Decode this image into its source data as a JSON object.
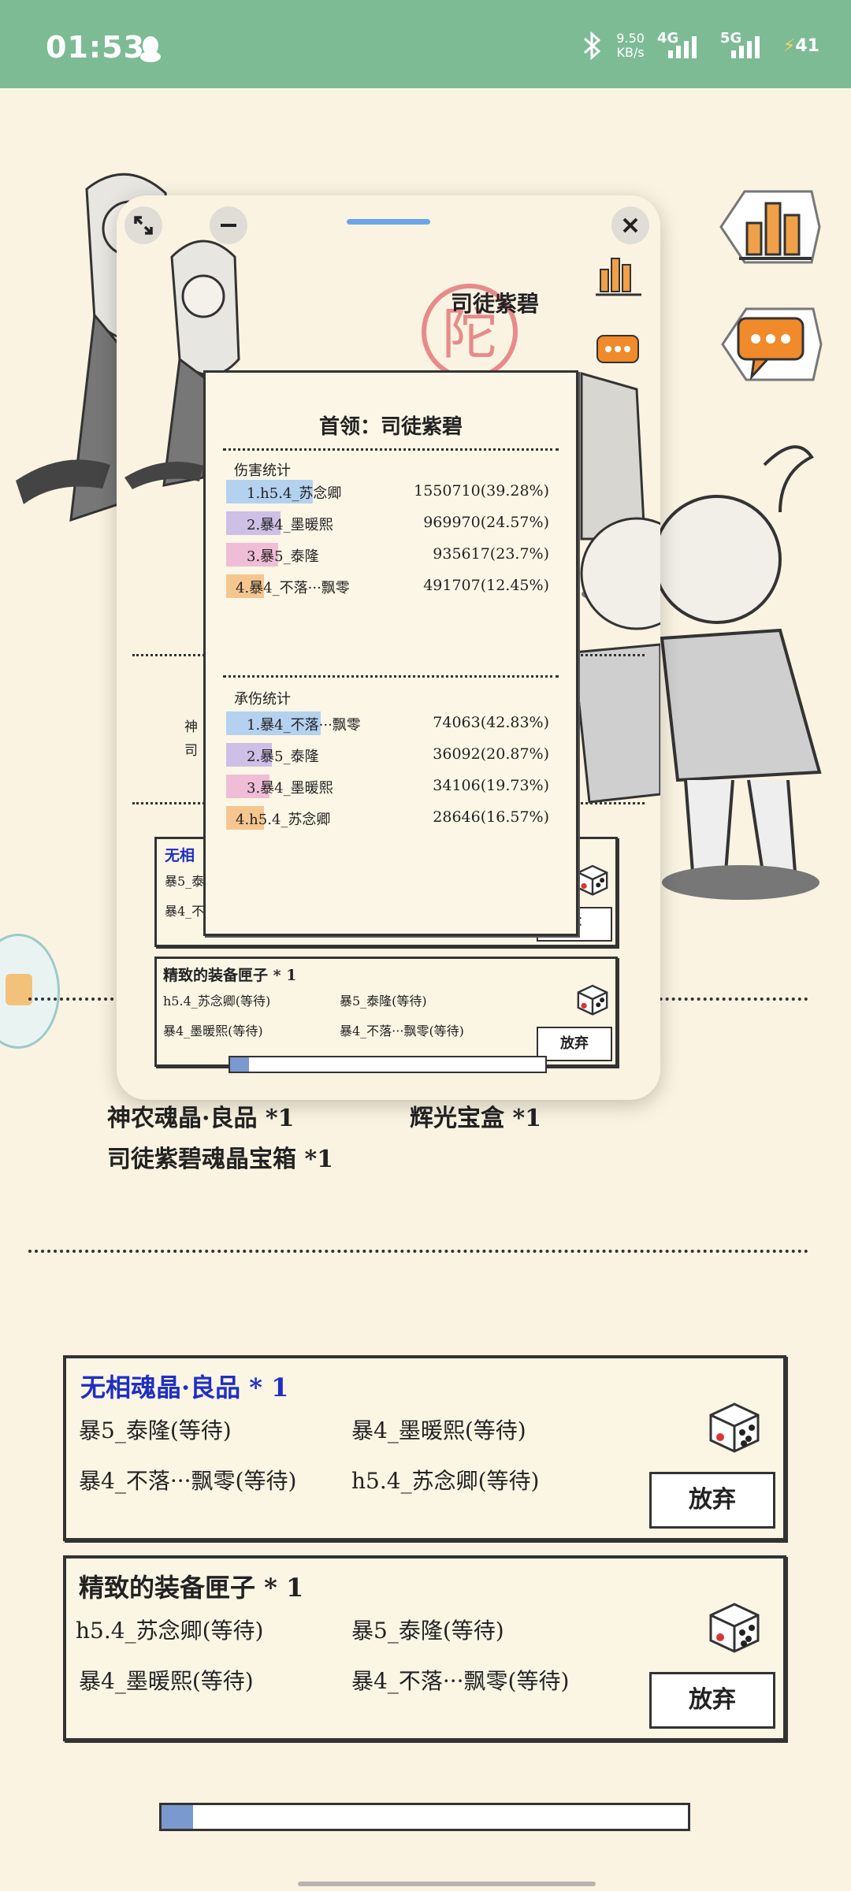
{
  "status_bar": {
    "time": "01:53",
    "net_speed_value": "9.50",
    "net_speed_unit": "KB/s",
    "sim1": "4G",
    "sim2": "5G",
    "battery": "41",
    "icons": [
      "qq-penguin-icon",
      "bluetooth-icon",
      "signal-icon",
      "battery-icon"
    ]
  },
  "background": {
    "rewards": {
      "line1_a": "神农魂晶·良品 *1",
      "line1_b": "辉光宝盒 *1",
      "line2": "司徒紫碧魂晶宝箱 *1"
    },
    "box1": {
      "title": "无相魂晶·良品 * 1",
      "p1": "暴5_泰隆(等待)",
      "p2": "暴4_墨暖熙(等待)",
      "p3": "暴4_不落···飘零(等待)",
      "p4": "h5.4_苏念卿(等待)",
      "button": "放弃"
    },
    "box2": {
      "title": "精致的装备匣子 * 1",
      "p1": "h5.4_苏念卿(等待)",
      "p2": "暴5_泰隆(等待)",
      "p3": "暴4_墨暖熙(等待)",
      "p4": "暴4_不落···飘零(等待)",
      "button": "放弃"
    },
    "progress": 0.06
  },
  "window": {
    "scene": {
      "boss_name": "司徒紫碧",
      "stamp_char": "陀",
      "partial_a": "神",
      "partial_b": "司",
      "box1_title": "无相",
      "box1_p1": "暴5_泰",
      "box1_p2": "暴4_不",
      "box1_button": "弃",
      "box2_title": "精致的装备匣子 * 1",
      "box2_p1": "h5.4_苏念卿(等待)",
      "box2_p2": "暴5_泰隆(等待)",
      "box2_p3": "暴4_墨暖熙(等待)",
      "box2_p4": "暴4_不落···飘零(等待)",
      "box2_button": "放弃",
      "progress": 0.06
    },
    "stats": {
      "boss_title": "首领：司徒紫碧",
      "damage_title": "伤害统计",
      "damage": [
        {
          "name": "1.h5.4_苏念卿",
          "value": "1550710(39.28%)",
          "fraction": 0.3928,
          "color": "#b4d1f0"
        },
        {
          "name": "2.暴4_墨暖熙",
          "value": "969970(24.57%)",
          "fraction": 0.2457,
          "color": "#cdbfe6"
        },
        {
          "name": "3.暴5_泰隆",
          "value": "935617(23.7%)",
          "fraction": 0.237,
          "color": "#f0bdd7"
        },
        {
          "name": "4.暴4_不落···飘零",
          "value": "491707(12.45%)",
          "fraction": 0.1245,
          "color": "#f6c690"
        }
      ],
      "taken_title": "承伤统计",
      "taken": [
        {
          "name": "1.暴4_不落···飘零",
          "value": "74063(42.83%)",
          "fraction": 0.4283,
          "color": "#b4d1f0"
        },
        {
          "name": "2.暴5_泰隆",
          "value": "36092(20.87%)",
          "fraction": 0.2087,
          "color": "#cdbfe6"
        },
        {
          "name": "3.暴4_墨暖熙",
          "value": "34106(19.73%)",
          "fraction": 0.1973,
          "color": "#f0bdd7"
        },
        {
          "name": "4.h5.4_苏念卿",
          "value": "28646(16.57%)",
          "fraction": 0.1657,
          "color": "#f6c690"
        }
      ]
    }
  }
}
